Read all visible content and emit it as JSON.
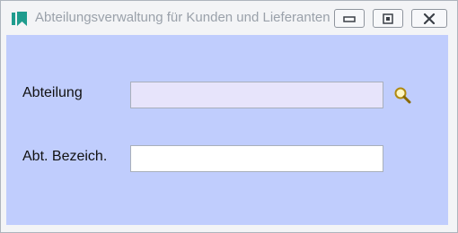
{
  "window": {
    "title": "Abteilungsverwaltung für Kunden und Lieferanten",
    "icon": "bookmark-icon",
    "controls": [
      "minimize-icon",
      "restore-icon",
      "close-icon"
    ]
  },
  "form": {
    "abteilung": {
      "label": "Abteilung",
      "value": "",
      "placeholder": ""
    },
    "bezeichnung": {
      "label": "Abt. Bezeich.",
      "value": "",
      "placeholder": ""
    },
    "lookup_icon": "magnifier-icon"
  },
  "colors": {
    "client_background": "#c0cdfd",
    "highlighted_field": "#e7e4fb",
    "app_icon": "#1f9c8e"
  }
}
